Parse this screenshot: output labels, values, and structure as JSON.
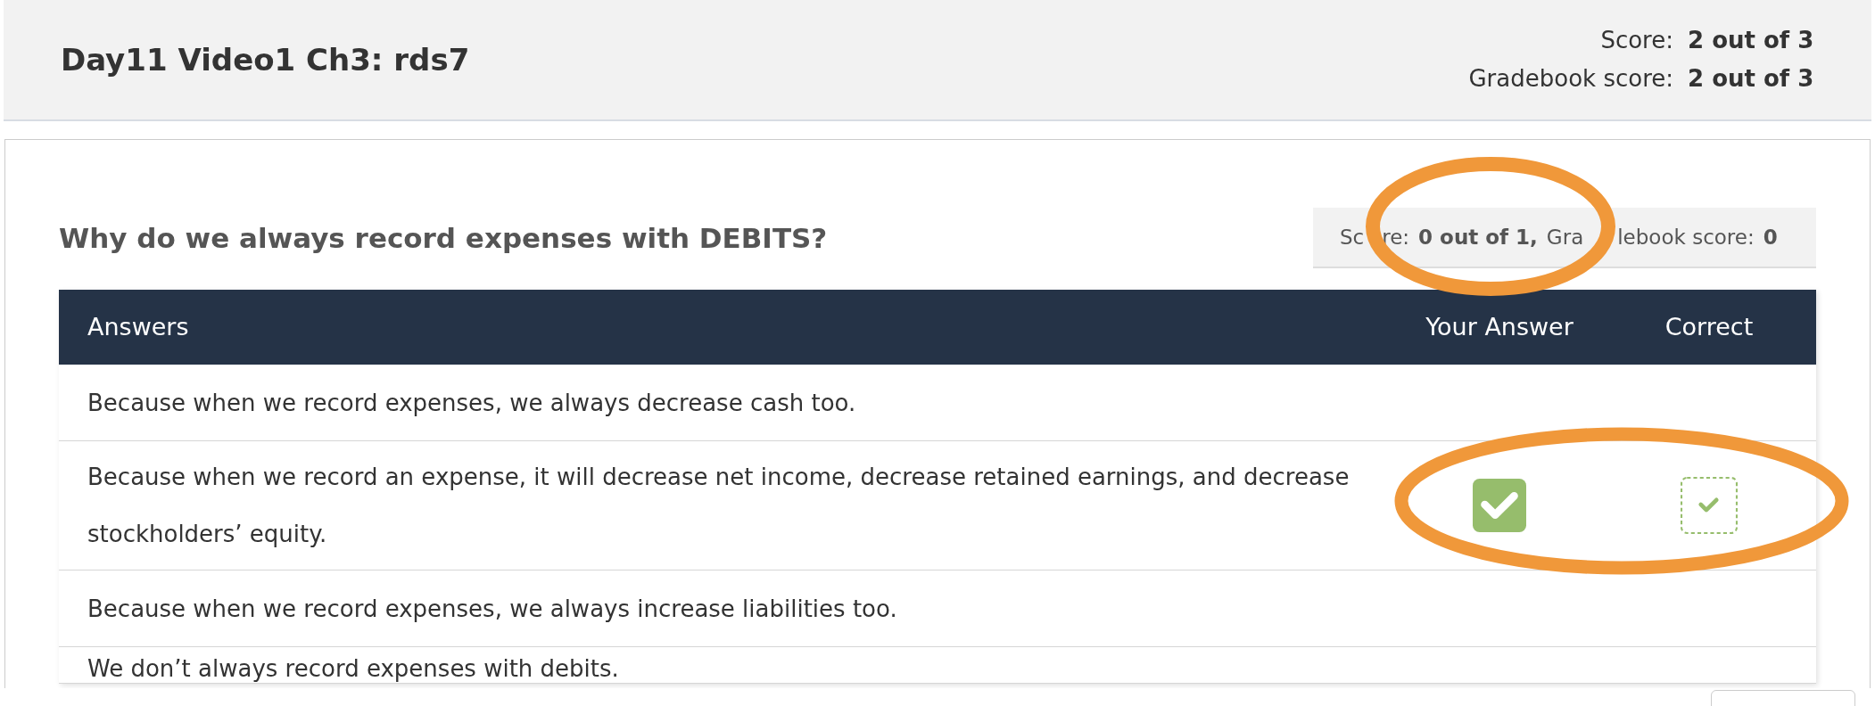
{
  "header": {
    "title": "Day11 Video1 Ch3: rds7",
    "scores": [
      {
        "label": "Score:",
        "value": "2 out of 3"
      },
      {
        "label": "Gradebook score:",
        "value": "2 out of 3"
      }
    ]
  },
  "question": {
    "text": "Why do we always record expenses with DEBITS?",
    "score_label": [
      "Sc",
      "re:"
    ],
    "score_value": "0 out of 1,",
    "gradebook_label": [
      "Gra",
      "lebook score:"
    ],
    "gradebook_value": "0"
  },
  "table": {
    "columns": [
      "Answers",
      "Your Answer",
      "Correct"
    ],
    "rows": [
      {
        "text": "Because when we record expenses, we always decrease cash too.",
        "your_answer": false,
        "correct": false
      },
      {
        "text": "Because when we record an expense, it will decrease net income, decrease retained earnings, and decrease stockholders’ equity.",
        "your_answer": true,
        "correct": true
      },
      {
        "text": "Because when we record expenses, we always increase liabilities too.",
        "your_answer": false,
        "correct": false
      },
      {
        "text": "We don’t always record expenses with debits.",
        "your_answer": false,
        "correct": false
      }
    ]
  }
}
